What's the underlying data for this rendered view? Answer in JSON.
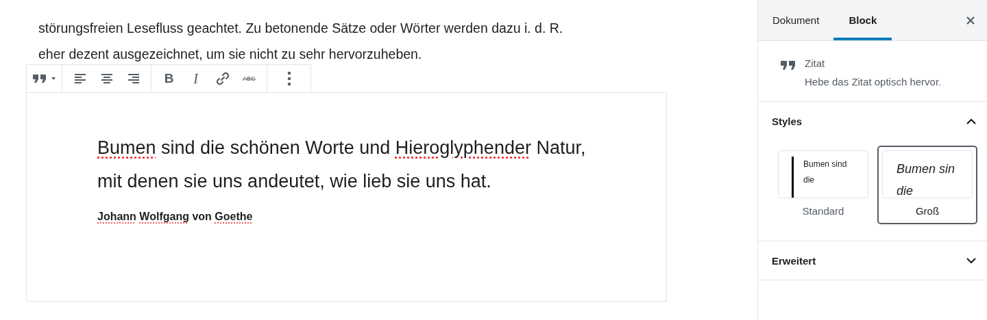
{
  "paragraph": {
    "lines": [
      "störungsfreien Lesefluss geachtet. Zu betonende Sätze oder Wörter werden dazu i. d. R.",
      "eher dezent ausgezeichnet, um sie nicht zu sehr hervorzuheben."
    ]
  },
  "toolbar": {
    "groups": [
      [
        {
          "kind": "quote"
        }
      ],
      [
        {
          "kind": "align-left"
        },
        {
          "kind": "align-center"
        },
        {
          "kind": "align-right"
        }
      ],
      [
        {
          "kind": "bold",
          "label": "B"
        },
        {
          "kind": "italic",
          "label": "I"
        },
        {
          "kind": "link"
        },
        {
          "kind": "strike",
          "label": "ABC"
        }
      ],
      [
        {
          "kind": "more"
        }
      ]
    ]
  },
  "quote": {
    "lines": [
      [
        {
          "text": "Bumen",
          "misspelled": true
        },
        {
          "text": " sind die schönen Worte und ",
          "misspelled": false
        },
        {
          "text": "Hieroglyphender",
          "misspelled": true
        },
        {
          "text": " Natur,",
          "misspelled": false
        }
      ],
      [
        {
          "text": "mit denen sie uns andeutet, wie lieb sie uns hat.",
          "misspelled": false
        }
      ]
    ],
    "citation": [
      {
        "text": "Johann",
        "misspelled": true
      },
      {
        "text": "Wolfgang",
        "misspelled": true
      },
      {
        "text": "von",
        "misspelled": false
      },
      {
        "text": "Goethe",
        "misspelled": true
      }
    ]
  },
  "sidebar": {
    "tabs": [
      {
        "label": "Dokument",
        "selected": false
      },
      {
        "label": "Block",
        "selected": true
      }
    ],
    "block": {
      "title": "Zitat",
      "description": "Hebe das Zitat optisch hervor."
    },
    "panels": [
      {
        "title": "Styles",
        "expanded": true,
        "styles": [
          {
            "kind": "default",
            "preview": [
              "Bumen sind",
              "die"
            ],
            "label": "Standard",
            "selected": false
          },
          {
            "kind": "large",
            "preview": [
              "Bumen sin",
              "die"
            ],
            "label": "Groß",
            "selected": true
          }
        ]
      },
      {
        "title": "Erweitert",
        "expanded": false
      }
    ]
  }
}
